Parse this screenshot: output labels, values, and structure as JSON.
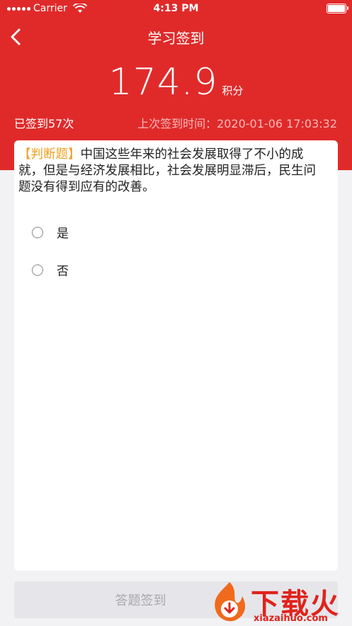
{
  "status_bar": {
    "carrier": "Carrier",
    "time": "4:13 PM"
  },
  "nav": {
    "title": "学习签到"
  },
  "summary": {
    "points": "174.9",
    "points_unit": "积分",
    "signed_count": "已签到57次",
    "last_sign_label": "上次签到时间",
    "last_sign_time": "上次签到时间：2020-01-06 17:03:32"
  },
  "question": {
    "tag": "【判断题】",
    "text": "中国这些年来的社会发展取得了不小的成就，但是与经济发展相比，社会发展明显滞后，民生问题没有得到应有的改善。",
    "options": [
      {
        "label": "是"
      },
      {
        "label": "否"
      }
    ]
  },
  "actions": {
    "submit_label": "答题签到"
  },
  "watermark": {
    "text": "下载火",
    "domain": "xiazaihuo.com"
  },
  "colors": {
    "header": "#e02a2a",
    "tag": "#f0a020",
    "watermark": "#e0231c"
  }
}
